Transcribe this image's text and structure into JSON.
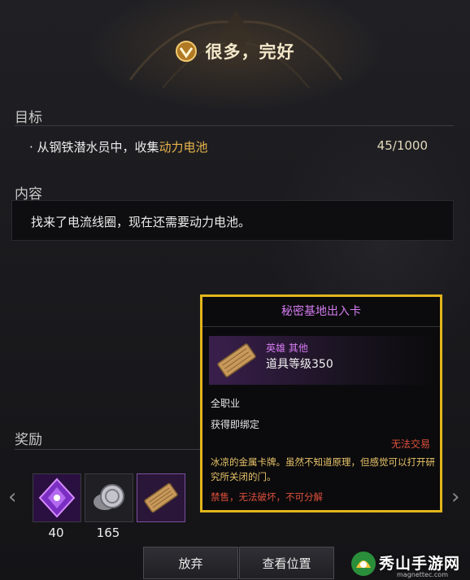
{
  "quest": {
    "title": "很多，完好",
    "objective_label": "目标",
    "objective_prefix": "· 从钢铁潜水员中，收集",
    "objective_item": "动力电池",
    "objective_progress": "45/1000",
    "content_label": "内容",
    "content_text": "找来了电流线圈，现在还需要动力电池。"
  },
  "rewards": {
    "label": "奖励",
    "items": [
      {
        "icon": "purple-crystal-icon",
        "count": "40"
      },
      {
        "icon": "silver-coin-icon",
        "count": "165"
      },
      {
        "icon": "wooden-card-icon",
        "count": ""
      }
    ]
  },
  "buttons": {
    "abandon": "放弃",
    "view_location": "查看位置"
  },
  "tooltip": {
    "name": "秘密基地出入卡",
    "rarity": "英雄 其他",
    "item_level": "道具等级350",
    "class": "全职业",
    "bind": "获得即绑定",
    "trade": "无法交易",
    "description": "冰凉的金属卡牌。虽然不知道原理，但感觉可以打开研究所关闭的门。",
    "flag_sell": "禁售",
    "flag_sep1": "，",
    "flag_destroy": "无法破坏",
    "flag_sep2": "，",
    "flag_split": "不可分解"
  },
  "watermark": {
    "main": "秀山手游网",
    "sub": "magnettec.com"
  },
  "colors": {
    "accent_gold": "#e2b51b",
    "highlight": "#e9b54b",
    "rarity_purple": "#d57cf0",
    "warning_red": "#e0503c",
    "desc_yellow": "#e9c46a"
  }
}
